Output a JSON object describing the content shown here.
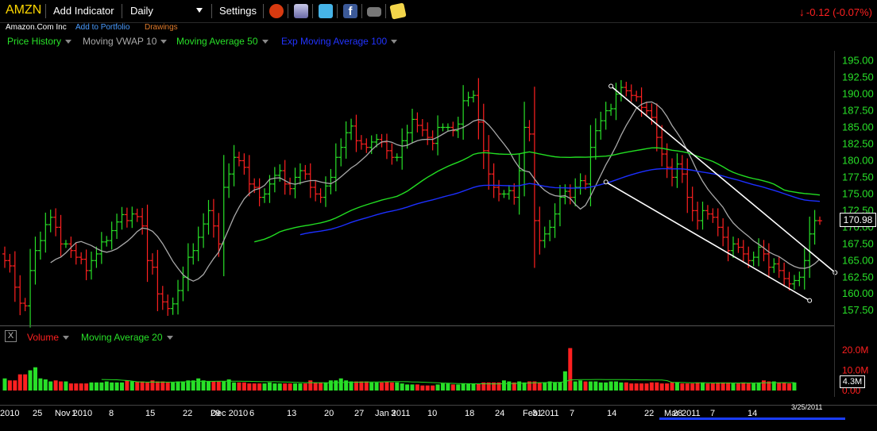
{
  "toolbar": {
    "ticker": "AMZN",
    "add_indicator": "Add Indicator",
    "period": "Daily",
    "settings": "Settings",
    "icons": [
      "alarm-clock-icon",
      "cube-icon",
      "twitter-icon",
      "facebook-icon",
      "camera-icon",
      "note-icon"
    ],
    "change": "-0.12 (-0.07%)"
  },
  "info": {
    "company": "Amazon.Com Inc",
    "add_portfolio": "Add to Portfolio",
    "drawings": "Drawings"
  },
  "legend": {
    "price_history": "Price History",
    "vwap": "Moving VWAP 10",
    "ma50": "Moving Average 50",
    "ema100": "Exp Moving Average 100",
    "volume": "Volume",
    "vol_ma": "Moving Average 20"
  },
  "colors": {
    "up": "#28e028",
    "down": "#ff2020",
    "vwap": "#a8a8a8",
    "ma50": "#22dd22",
    "ema100": "#1c2fff",
    "trendline": "#ffffff"
  },
  "readouts": {
    "last_price": "170.98",
    "last_volume": "4.3M",
    "cursor_date": "3/25/2011"
  },
  "chart_data": [
    {
      "type": "bar",
      "series_kind": "OHLC",
      "y_ticks": [
        "157.50",
        "160.00",
        "162.50",
        "165.00",
        "167.50",
        "170.00",
        "172.50",
        "175.00",
        "177.50",
        "180.00",
        "182.50",
        "185.00",
        "187.50",
        "190.00",
        "192.50",
        "195.00"
      ],
      "ylim": [
        155.5,
        196.5
      ],
      "x_tick_labels": [
        "2010",
        "25",
        "Nov 2010",
        "1",
        "8",
        "15",
        "22",
        "29",
        "Dec 2010",
        "6",
        "13",
        "20",
        "27",
        "3",
        "Jan 2011",
        "10",
        "18",
        "24",
        "31",
        "Feb 2011",
        "7",
        "14",
        "22",
        "28",
        "Mar 2011",
        "7",
        "14"
      ],
      "closes": [
        165,
        164.2,
        161,
        158.6,
        158.2,
        163.5,
        166.5,
        168,
        170.4,
        171.5,
        170,
        167.5,
        167.5,
        166.5,
        165.5,
        165.2,
        163.5,
        165,
        166,
        167.8,
        168,
        169.5,
        170.8,
        171.9,
        171,
        172,
        171.6,
        170.2,
        165,
        164,
        160,
        158.8,
        157.8,
        158.5,
        160.5,
        162.5,
        165.5,
        166.5,
        168.5,
        170.5,
        172.5,
        170.2,
        167.5,
        176,
        178,
        180.5,
        180,
        179,
        176.5,
        176,
        174.5,
        175,
        176.5,
        177.8,
        178.5,
        176.5,
        175.8,
        177.5,
        178.5,
        178,
        176,
        175,
        174.5,
        176.2,
        177.5,
        180.5,
        182,
        184.2,
        185.2,
        183,
        182.5,
        182,
        182.8,
        183.2,
        182.8,
        181.5,
        180.5,
        180.5,
        183,
        184.2,
        186.2,
        185.3,
        184.6,
        183.5,
        182.6,
        185,
        185,
        185,
        184.5,
        185.5,
        189,
        189.5,
        189.8,
        185.8,
        181.5,
        178,
        176,
        175,
        175,
        175.5,
        174.5,
        178.5,
        185,
        184,
        171,
        168,
        169,
        170,
        172,
        174.5,
        175.4,
        174.5,
        176,
        177,
        176.5,
        182,
        184.5,
        186,
        187.5,
        187.8,
        190,
        191,
        190.5,
        189.8,
        189.6,
        188,
        187.5,
        186.5,
        183.5,
        181,
        179,
        177.5,
        179.5,
        178,
        174.5,
        172.5,
        171,
        172.5,
        172,
        171.5,
        170,
        168.5,
        166.5,
        167.5,
        167,
        166,
        165,
        165.5,
        167,
        166,
        164,
        164.5,
        163.5,
        162.3,
        161.5,
        162,
        162.5,
        165,
        169,
        171,
        170.98
      ],
      "volume_ylim_millions": [
        0,
        22
      ],
      "volume_ticks": [
        "20.0M",
        "10.0M",
        "0.00"
      ],
      "volume_millions": [
        6,
        5,
        5,
        8,
        8,
        10,
        11.5,
        6,
        5.5,
        4.5,
        5,
        4.5,
        4.5,
        3.5,
        3.5,
        3.5,
        3.5,
        4,
        4,
        4,
        4.5,
        4,
        4,
        4,
        5,
        4.5,
        4.5,
        4.5,
        4,
        5,
        4.5,
        4.5,
        4,
        4,
        4.5,
        4.5,
        5,
        5,
        6,
        5,
        4.5,
        4.5,
        4.5,
        4.5,
        5.5,
        4,
        4,
        4,
        3.5,
        3.5,
        3.5,
        3.5,
        4,
        3.5,
        3.5,
        3.5,
        3.5,
        3.5,
        3.5,
        3.5,
        5,
        4,
        4,
        4,
        5,
        5,
        6,
        5,
        4.5,
        4.5,
        4.5,
        4.5,
        4,
        4,
        4,
        4.5,
        4,
        4,
        3.5,
        3,
        3,
        3,
        2.5,
        2.5,
        2.5,
        3,
        3.5,
        3.5,
        3,
        3,
        3.5,
        3.5,
        3.5,
        3.5,
        4,
        4,
        4,
        4,
        5,
        4.5,
        4,
        4.5,
        4,
        4.5,
        4.5,
        4,
        4,
        4.5,
        4,
        4,
        4,
        4.5,
        4.5,
        5,
        4.5,
        4.5,
        4.5,
        4,
        4,
        4.5,
        4.5,
        4,
        4,
        3.5,
        3.5,
        3.5,
        3.5,
        4,
        4,
        3.5,
        3.5,
        4,
        4,
        3.5,
        3.5,
        3.5,
        4,
        4,
        3.5,
        3.5,
        4,
        4,
        4,
        3.5,
        3.5,
        4,
        3.5,
        3.5,
        4,
        5,
        4.5,
        4.5,
        4,
        4,
        3.5,
        4
      ],
      "volume_highlights": [
        {
          "index": 111,
          "value": 21
        },
        {
          "index": 110,
          "value": 9.5
        }
      ]
    }
  ]
}
